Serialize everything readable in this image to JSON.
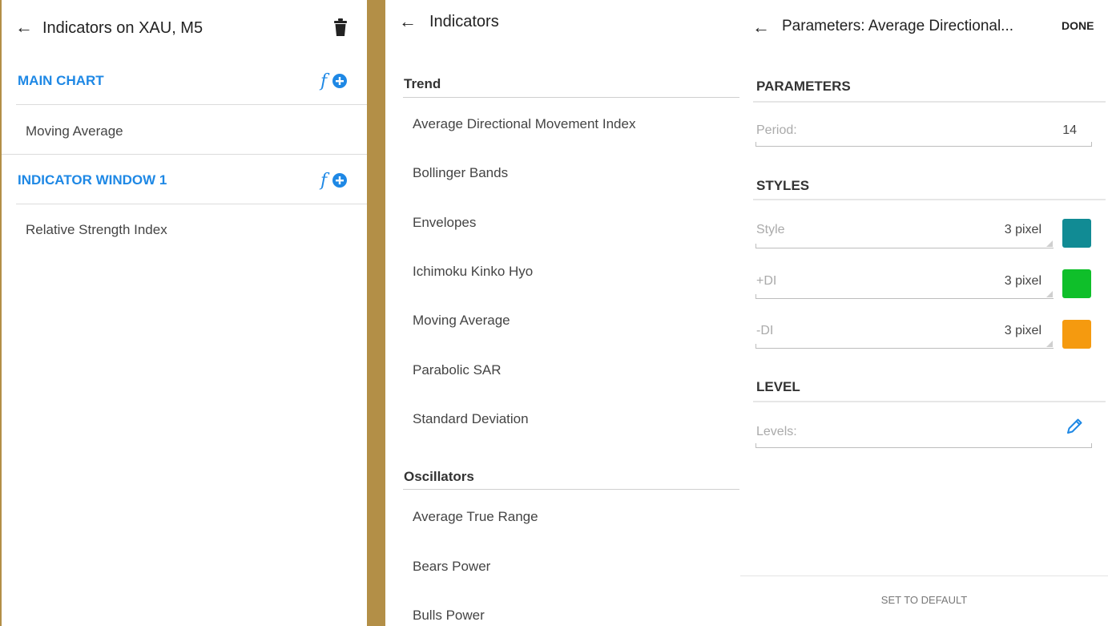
{
  "panel1": {
    "title": "Indicators on XAU, M5",
    "sections": [
      {
        "title": "MAIN CHART",
        "items": [
          "Moving Average"
        ]
      },
      {
        "title": "INDICATOR WINDOW 1",
        "items": [
          "Relative Strength Index"
        ]
      }
    ]
  },
  "panel2": {
    "title": "Indicators",
    "groups": [
      {
        "title": "Trend",
        "items": [
          "Average Directional Movement Index",
          "Bollinger Bands",
          "Envelopes",
          "Ichimoku Kinko Hyo",
          "Moving Average",
          "Parabolic SAR",
          "Standard Deviation"
        ]
      },
      {
        "title": "Oscillators",
        "items": [
          "Average True Range",
          "Bears Power",
          "Bulls Power"
        ]
      }
    ]
  },
  "panel3": {
    "title": "Parameters: Average Directional...",
    "done_label": "DONE",
    "parameters": {
      "title": "PARAMETERS",
      "period_label": "Period:",
      "period_value": "14"
    },
    "styles": {
      "title": "STYLES",
      "rows": [
        {
          "label": "Style",
          "value": "3 pixel",
          "color": "#118b94"
        },
        {
          "label": "+DI",
          "value": "3 pixel",
          "color": "#0fbf2a"
        },
        {
          "label": "-DI",
          "value": "3 pixel",
          "color": "#f59a0f"
        }
      ]
    },
    "level": {
      "title": "LEVEL",
      "levels_label": "Levels:"
    },
    "set_default_label": "SET TO DEFAULT"
  },
  "colors": {
    "accent_blue": "#1e88e5",
    "gold_divider": "#b38f47"
  },
  "icons": [
    "back-arrow-icon",
    "trash-icon",
    "add-function-icon",
    "pencil-icon"
  ]
}
